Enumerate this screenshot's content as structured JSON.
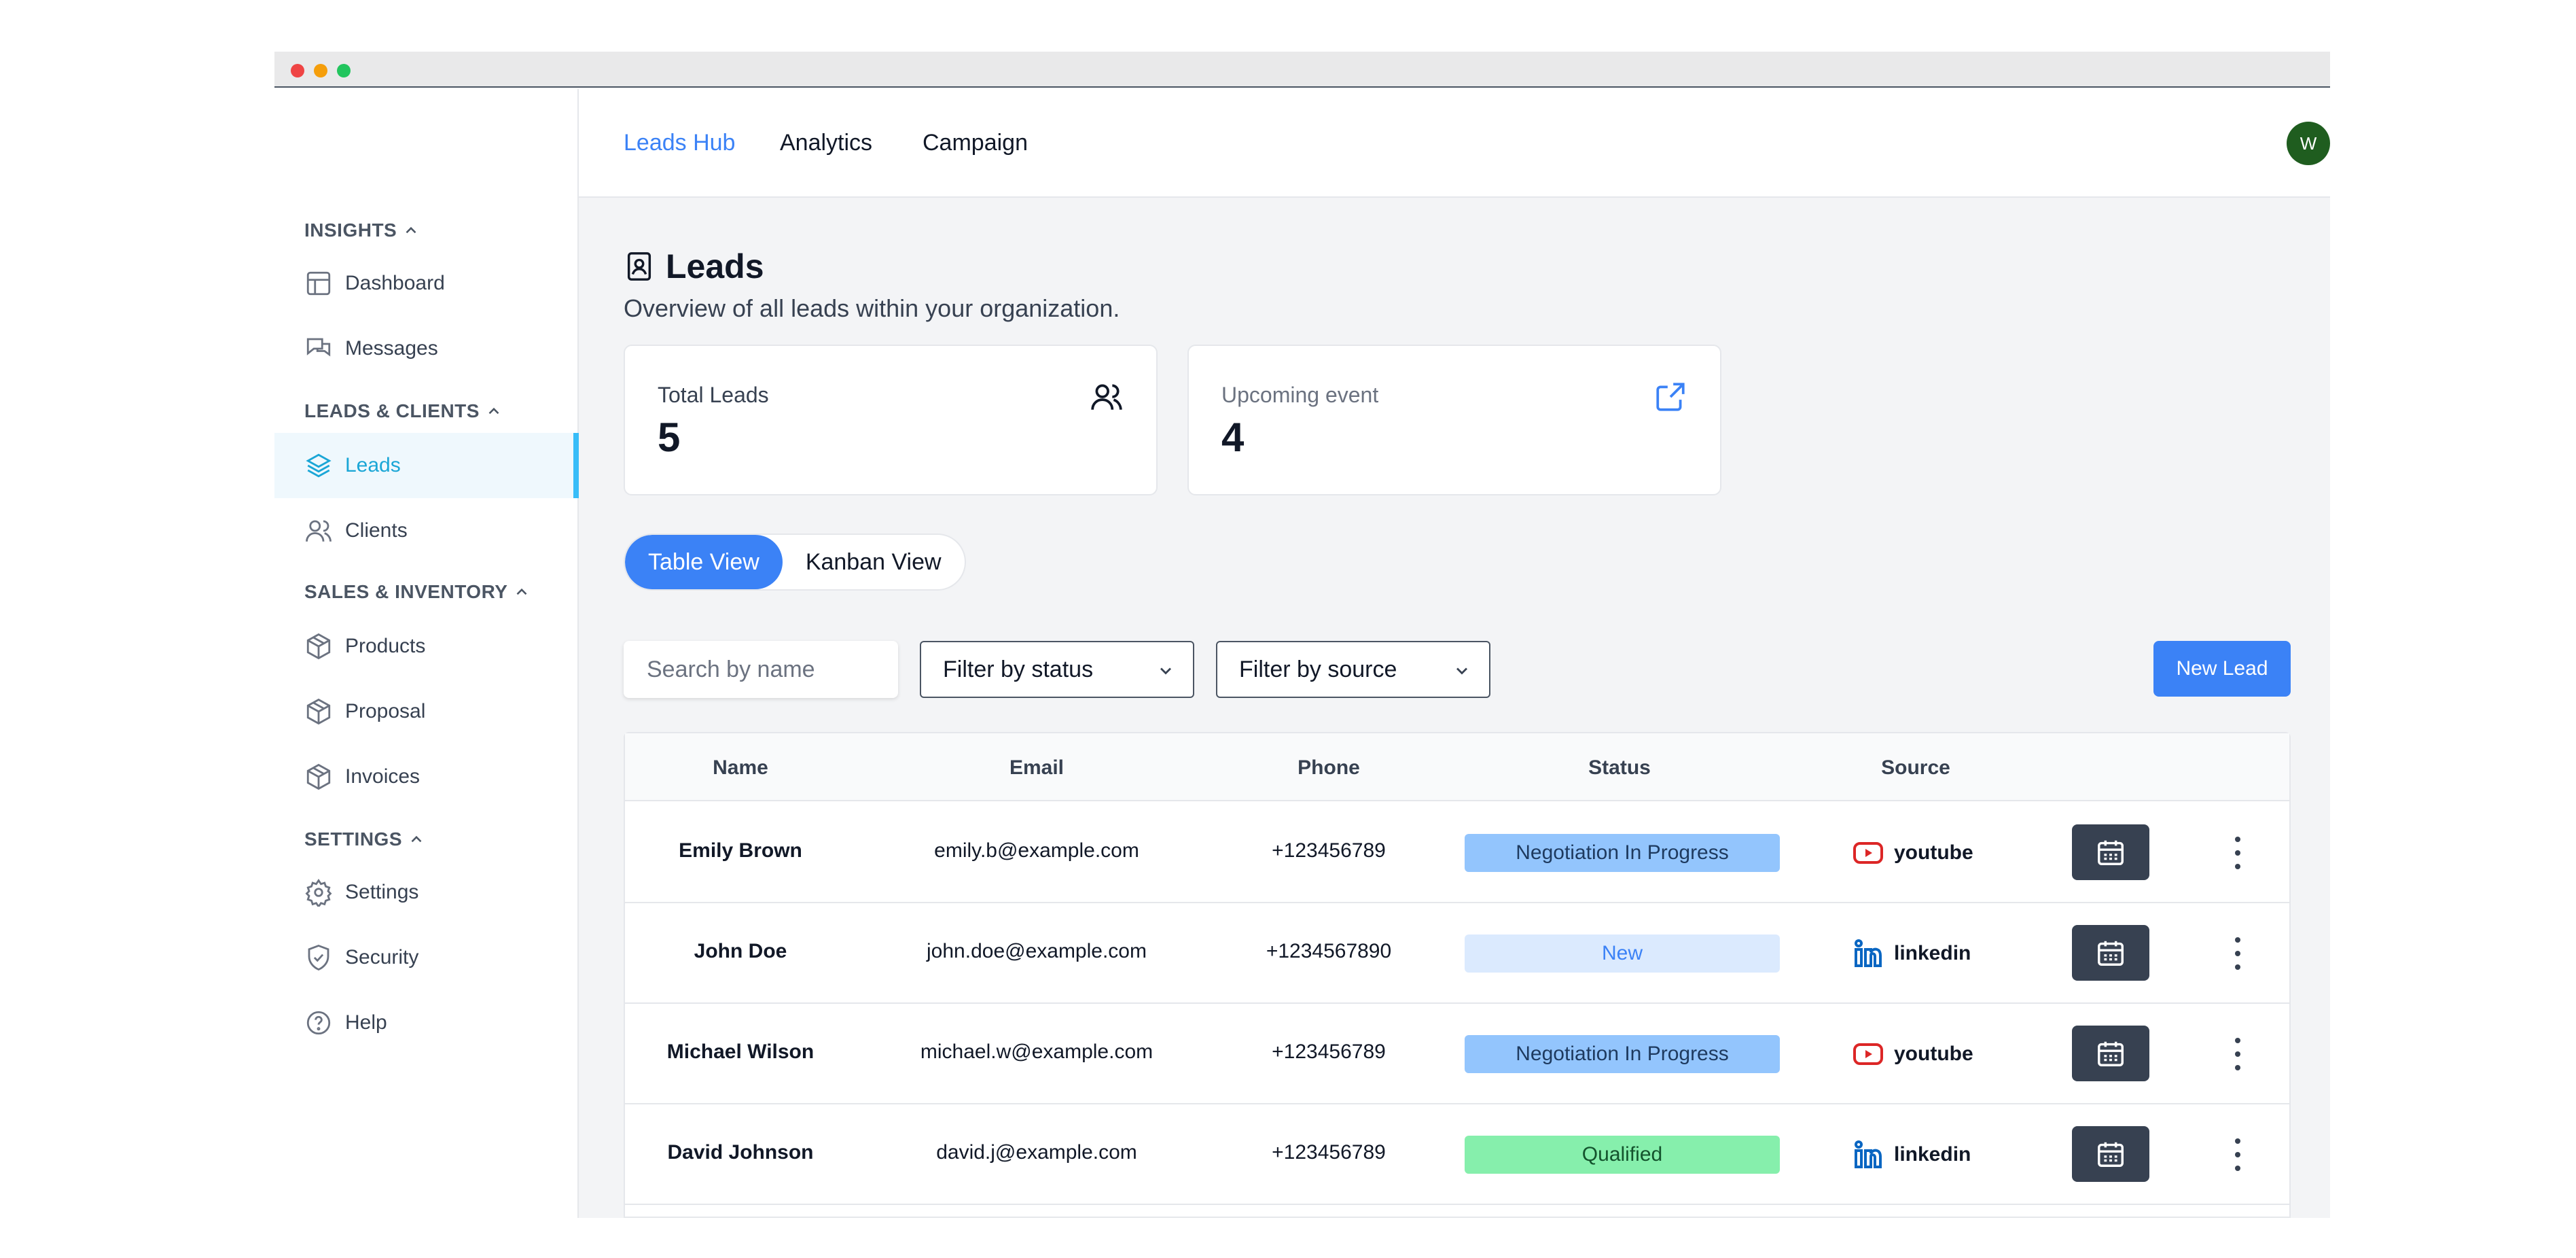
{
  "sidebar": {
    "sections": [
      {
        "title": "INSIGHTS",
        "items": [
          {
            "label": "Dashboard",
            "icon": "layout-icon"
          },
          {
            "label": "Messages",
            "icon": "messages-icon"
          }
        ]
      },
      {
        "title": "LEADS & CLIENTS",
        "items": [
          {
            "label": "Leads",
            "icon": "layers-icon",
            "active": true
          },
          {
            "label": "Clients",
            "icon": "users-icon"
          }
        ]
      },
      {
        "title": "SALES & INVENTORY",
        "items": [
          {
            "label": "Products",
            "icon": "box-icon"
          },
          {
            "label": "Proposal",
            "icon": "box-icon"
          },
          {
            "label": "Invoices",
            "icon": "box-icon"
          }
        ]
      },
      {
        "title": "SETTINGS",
        "items": [
          {
            "label": "Settings",
            "icon": "gear-icon"
          },
          {
            "label": "Security",
            "icon": "shield-icon"
          },
          {
            "label": "Help",
            "icon": "help-icon"
          }
        ]
      }
    ]
  },
  "topnav": {
    "tabs": [
      {
        "label": "Leads Hub",
        "active": true
      },
      {
        "label": "Analytics"
      },
      {
        "label": "Campaign"
      }
    ],
    "avatar_initial": "W"
  },
  "page": {
    "title": "Leads",
    "subtitle": "Overview of all leads within your organization."
  },
  "cards": [
    {
      "label": "Total Leads",
      "value": "5",
      "icon": "users-icon"
    },
    {
      "label": "Upcoming event",
      "value": "4",
      "icon": "external-link-icon"
    }
  ],
  "view_toggle": {
    "table": "Table View",
    "kanban": "Kanban View"
  },
  "filters": {
    "search_placeholder": "Search by name",
    "status": "Filter by status",
    "source": "Filter by source",
    "new_lead": "New Lead"
  },
  "table": {
    "headers": [
      "Name",
      "Email",
      "Phone",
      "Status",
      "Source"
    ],
    "rows": [
      {
        "name": "Emily Brown",
        "email": "emily.b@example.com",
        "phone": "+123456789",
        "status": "Negotiation In Progress",
        "source": "youtube"
      },
      {
        "name": "John Doe",
        "email": "john.doe@example.com",
        "phone": "+1234567890",
        "status": "New",
        "source": "linkedin"
      },
      {
        "name": "Michael Wilson",
        "email": "michael.w@example.com",
        "phone": "+123456789",
        "status": "Negotiation In Progress",
        "source": "youtube"
      },
      {
        "name": "David Johnson",
        "email": "david.j@example.com",
        "phone": "+123456789",
        "status": "Qualified",
        "source": "linkedin"
      }
    ]
  },
  "colors": {
    "accent": "#3b82f6",
    "sidebar_active": "#1aa6d6",
    "status_negotiation": "#93c5fd",
    "status_new": "#dbeafe",
    "status_qualified": "#86efac"
  }
}
